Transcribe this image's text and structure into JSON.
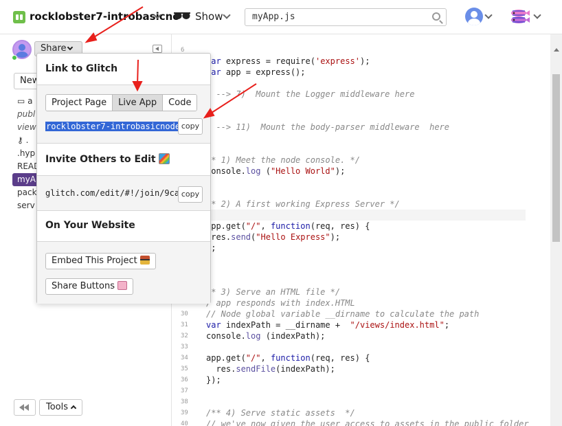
{
  "header": {
    "project_name": "rocklobster7-introbasicno",
    "show_label": "Show",
    "search_value": "myApp.js"
  },
  "sidebar": {
    "share_label": "Share",
    "new_label": "New",
    "files": [
      {
        "label": "a",
        "style": "normal",
        "icon": "archive-icon"
      },
      {
        "label": "publ",
        "style": "italic"
      },
      {
        "label": "view",
        "style": "italic"
      },
      {
        "label": ".",
        "style": "normal",
        "icon": "key-icon"
      },
      {
        "label": ".hyp",
        "style": "normal"
      },
      {
        "label": "READ",
        "style": "normal"
      },
      {
        "label": "myAp",
        "style": "active"
      },
      {
        "label": "pack",
        "style": "normal"
      },
      {
        "label": "serv",
        "style": "normal"
      }
    ],
    "tools_label": "Tools"
  },
  "popover": {
    "link_title": "Link to Glitch",
    "tabs": [
      "Project Page",
      "Live App",
      "Code"
    ],
    "active_tab": "Live App",
    "live_url": "rocklobster7-introbasicnode",
    "copy_label": "copy",
    "invite_title": "Invite Others to Edit",
    "invite_url": "glitch.com/edit/#!/join/9ca",
    "website_title": "On Your Website",
    "embed_label": "Embed This Project",
    "share_buttons_label": "Share Buttons"
  },
  "editor": {
    "lines": [
      {
        "n": "6",
        "text": ""
      },
      {
        "n": "",
        "text": "var express = require('express');"
      },
      {
        "n": "",
        "text": "var app = express();"
      },
      {
        "n": "",
        "text": ""
      },
      {
        "n": "",
        "text": "/ --> 7)  Mount the Logger middleware here"
      },
      {
        "n": "",
        "text": ""
      },
      {
        "n": "",
        "text": ""
      },
      {
        "n": "",
        "text": "/ --> 11)  Mount the body-parser middleware  here"
      },
      {
        "n": "",
        "text": ""
      },
      {
        "n": "",
        "text": ""
      },
      {
        "n": "",
        "text": "** 1) Meet the node console. */"
      },
      {
        "n": "",
        "text": "console.log (\"Hello World\");"
      },
      {
        "n": "",
        "text": ""
      },
      {
        "n": "",
        "text": ""
      },
      {
        "n": "",
        "text": "** 2) A first working Express Server */"
      },
      {
        "n": "",
        "text": "*"
      },
      {
        "n": "",
        "text": "app.get(\"/\", function(req, res) {"
      },
      {
        "n": "",
        "text": " res.send(\"Hello Express\");"
      },
      {
        "n": "",
        "text": ");"
      },
      {
        "n": "",
        "text": "/"
      },
      {
        "n": "",
        "text": ""
      },
      {
        "n": "",
        "text": ""
      },
      {
        "n": "",
        "text": "** 3) Serve an HTML file */"
      },
      {
        "n": "",
        "text": "/ app responds with index.HTML"
      },
      {
        "n": "30",
        "text": "// Node global variable __dirname to calculate the path"
      },
      {
        "n": "31",
        "text": "var indexPath = __dirname +  \"/views/index.html\";"
      },
      {
        "n": "32",
        "text": "console.log (indexPath);"
      },
      {
        "n": "33",
        "text": ""
      },
      {
        "n": "34",
        "text": "app.get(\"/\", function(req, res) {"
      },
      {
        "n": "35",
        "text": "  res.sendFile(indexPath);"
      },
      {
        "n": "36",
        "text": "});"
      },
      {
        "n": "37",
        "text": ""
      },
      {
        "n": "38",
        "text": ""
      },
      {
        "n": "39",
        "text": "/** 4) Serve static assets  */"
      },
      {
        "n": "40",
        "text": "// we've now given the user access to assets in the public folder"
      }
    ]
  },
  "colors": {
    "accent": "#5b3d8a",
    "selection": "#3367d6",
    "arrow": "#e8201c"
  }
}
